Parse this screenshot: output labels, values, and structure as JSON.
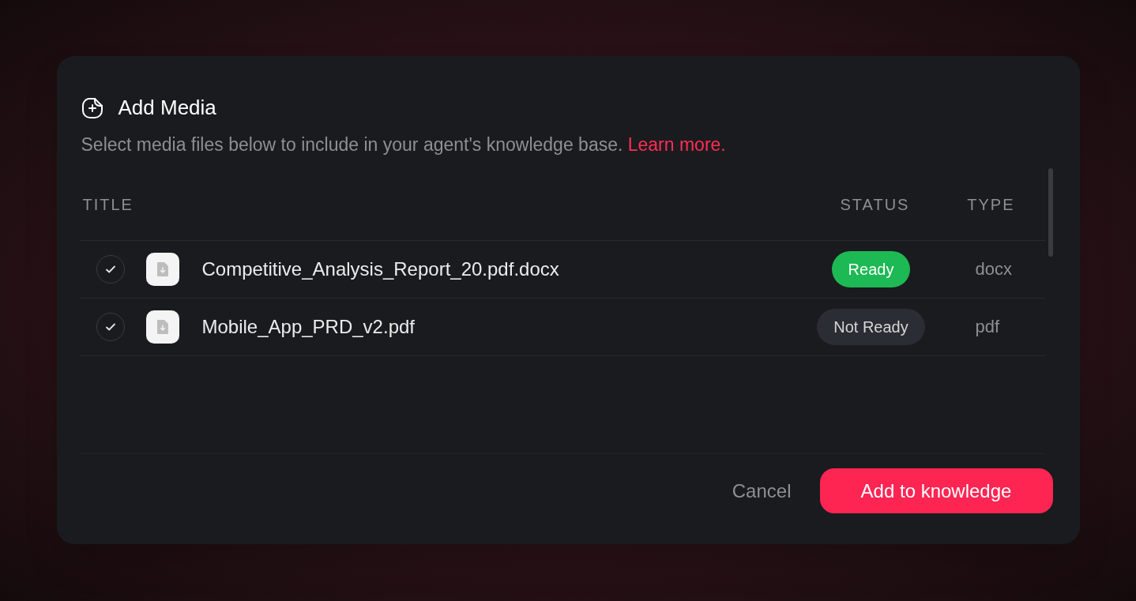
{
  "dialog": {
    "title": "Add Media",
    "description": "Select media files below to include in your agent's knowledge base.",
    "link": "Learn more."
  },
  "table": {
    "columns": [
      "TITLE",
      "STATUS",
      "TYPE"
    ],
    "rows": [
      {
        "checked": true,
        "title": "Competitive_Analysis_Report_20.pdf.docx",
        "status": {
          "kind": "ready",
          "label": "Ready"
        },
        "type": "docx"
      },
      {
        "checked": true,
        "title": "Mobile_App_PRD_v2.pdf",
        "status": {
          "kind": "not_ready",
          "label": "Not Ready"
        },
        "type": "pdf"
      }
    ]
  },
  "buttons": {
    "cancel": "Cancel",
    "confirm": "Add to knowledge"
  }
}
